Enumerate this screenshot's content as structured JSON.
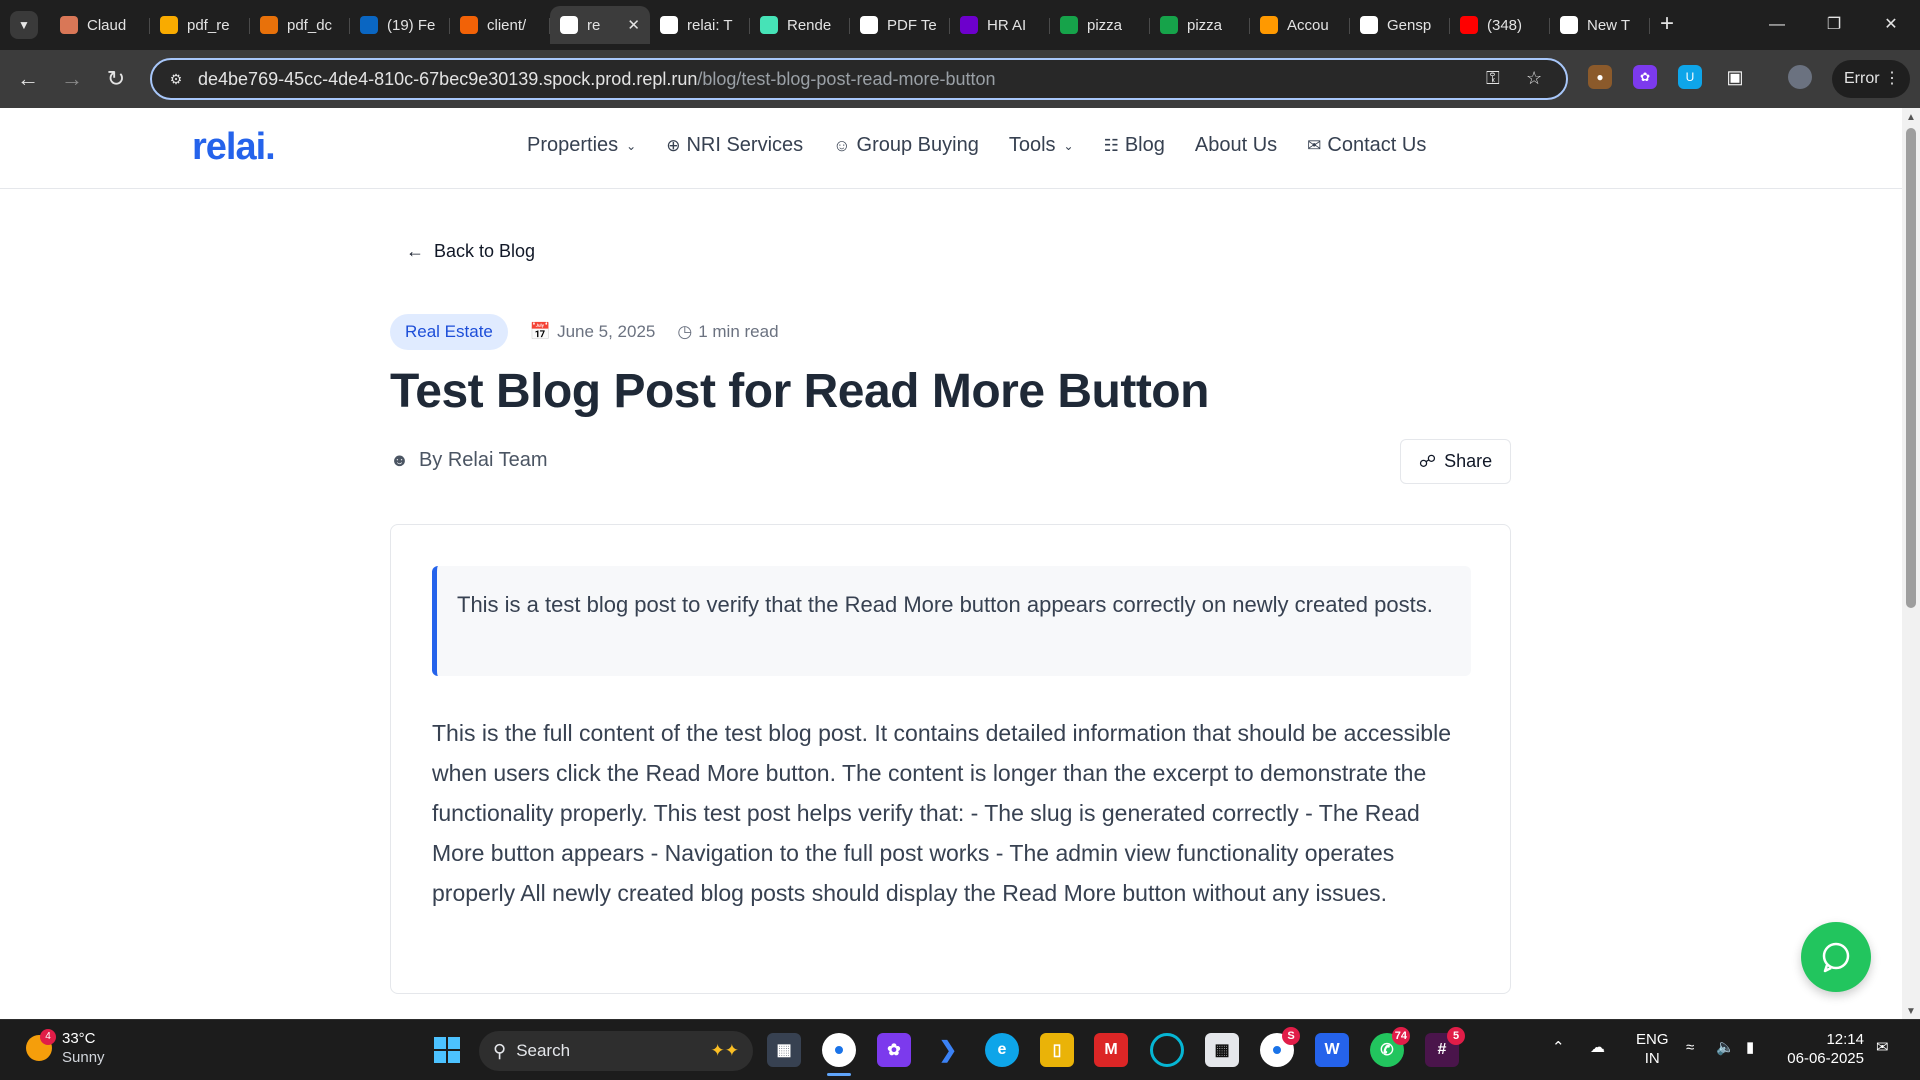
{
  "browser": {
    "tabs": [
      {
        "label": "Claud",
        "favicon": "claude-icon",
        "color": "#d97757"
      },
      {
        "label": "pdf_re",
        "favicon": "colab-icon",
        "color": "#f9ab00"
      },
      {
        "label": "pdf_dc",
        "favicon": "colab-icon",
        "color": "#e8710a"
      },
      {
        "label": "(19) Fe",
        "favicon": "linkedin-icon",
        "color": "#0a66c2"
      },
      {
        "label": "client/",
        "favicon": "replit-icon",
        "color": "#f26207"
      },
      {
        "label": "re",
        "favicon": "relai-icon",
        "color": "#ffffff",
        "active": true
      },
      {
        "label": "relai: T",
        "favicon": "relai-icon",
        "color": "#ffffff"
      },
      {
        "label": "Rende",
        "favicon": "render-icon",
        "color": "#46e3b7"
      },
      {
        "label": "PDF Te",
        "favicon": "openai-icon",
        "color": "#ffffff"
      },
      {
        "label": "HR AI",
        "favicon": "make-icon",
        "color": "#6d00cc"
      },
      {
        "label": "pizza",
        "favicon": "pi-icon",
        "color": "#16a34a"
      },
      {
        "label": "pizza",
        "favicon": "pi-icon",
        "color": "#16a34a"
      },
      {
        "label": "Accou",
        "favicon": "aws-icon",
        "color": "#ff9900"
      },
      {
        "label": "Gensp",
        "favicon": "genspark-icon",
        "color": "#ffffff"
      },
      {
        "label": "(348)",
        "favicon": "youtube-icon",
        "color": "#ff0000"
      },
      {
        "label": "New T",
        "favicon": "globe-icon",
        "color": "#ffffff"
      }
    ],
    "url_host": "de4be769-45cc-4de4-810c-67bec9e30139.spock.prod.repl.run",
    "url_path": "/blog/test-blog-post-read-more-button",
    "profile_status": "Error"
  },
  "site": {
    "logo": "relai.",
    "nav": [
      {
        "label": "Properties",
        "icon": "",
        "dropdown": true
      },
      {
        "label": "NRI Services",
        "icon": "globe-icon",
        "dropdown": false
      },
      {
        "label": "Group Buying",
        "icon": "users-icon",
        "dropdown": false
      },
      {
        "label": "Tools",
        "icon": "",
        "dropdown": true
      },
      {
        "label": "Blog",
        "icon": "book-icon",
        "dropdown": false
      },
      {
        "label": "About Us",
        "icon": "",
        "dropdown": false
      },
      {
        "label": "Contact Us",
        "icon": "mail-icon",
        "dropdown": false
      }
    ]
  },
  "post": {
    "back_label": "Back to Blog",
    "category": "Real Estate",
    "date": "June 5, 2025",
    "read_time": "1 min read",
    "title": "Test Blog Post for Read More Button",
    "author": "By Relai Team",
    "share_label": "Share",
    "excerpt": "This is a test blog post to verify that the Read More button appears correctly on newly created posts.",
    "content": "This is the full content of the test blog post. It contains detailed information that should be accessible when users click the Read More button. The content is longer than the excerpt to demonstrate the functionality properly. This test post helps verify that: - The slug is generated correctly - The Read More button appears - Navigation to the full post works - The admin view functionality operates properly All newly created blog posts should display the Read More button without any issues."
  },
  "colors": {
    "brand": "#2563eb",
    "badge_bg": "#e0ebff",
    "whatsapp": "#22c55e"
  },
  "taskbar": {
    "weather_badge": "4",
    "temperature": "33°C",
    "condition": "Sunny",
    "search_placeholder": "Search",
    "chrome_badge": "S",
    "whatsapp_badge": "74",
    "slack_badge": "5",
    "language": "ENG",
    "region": "IN",
    "time": "12:14",
    "date": "06-06-2025"
  }
}
